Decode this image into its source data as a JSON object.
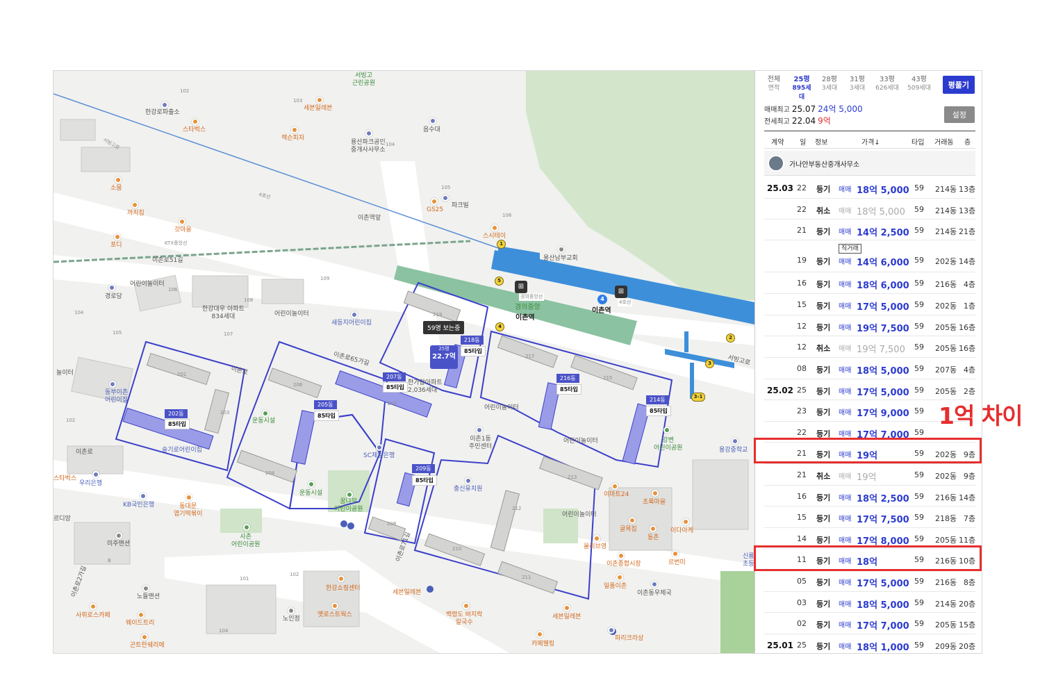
{
  "map": {
    "labels": {
      "seobinggo_park": "서빙고\n근린공원",
      "l102a": "102",
      "l103a": "103",
      "hangangro_police": "한강로파출소",
      "sebun_eleven_top": "세븐일레븐",
      "starbucks_top": "스타벅스",
      "jeksonpizza": "잭슨피자",
      "eumsudae": "음수대",
      "yongsan_park_agency": "용산파크공인\n중개사사무소",
      "l104a": "104",
      "l105a": "105",
      "gs25": "GS25",
      "parkbill": "파크빌",
      "l106a": "106",
      "seobinggoro": "서빙고로",
      "sopung": "소뭄",
      "kkachijip": "까치집",
      "gatmaeul": "갓마을",
      "podi": "포디",
      "ichon_station_name": "이촌역앞",
      "line4": "4호선",
      "ktx_jungang": "KTX중앙선",
      "steitei": "스시테이",
      "yongsan_church": "용산남부교회",
      "ichonro51": "이촌로51길",
      "kids_house": "어린이놀이터",
      "l106b": "106",
      "gyeongrodang": "경로당",
      "l104b": "104",
      "l105b": "105",
      "l108": "108",
      "l109": "109",
      "l107": "107",
      "hangang_daewoo": "한강대우 아파트\n834세대",
      "kids_house2": "어린이놀이터",
      "saedeungji_kindergarten": "새등지어린이집",
      "gyeongui_jungang": "경의중앙",
      "ichon_station": "이촌역",
      "ichon_station2": "이촌역",
      "gyeongui_line": "경의중앙선",
      "line4_badge": "4호선",
      "ichonro65": "이촌로65가길",
      "ichonro": "이촌로",
      "ichonro2": "이촌로",
      "dongbu_kindergarten": "동부이촌\n어린이집",
      "noriter_left": "놀이터",
      "l102b": "102",
      "l201": "201",
      "l203": "203",
      "l206": "206",
      "l207": "207",
      "l219": "219",
      "l217": "217",
      "l215": "215",
      "l204": "204",
      "l208": "208",
      "l210": "210",
      "l211": "211",
      "l212": "212",
      "l213": "213",
      "undong1": "운동시설",
      "undong2": "운동시설",
      "sc_bank": "SC제일은행",
      "kkumnamu": "꿈나무\n어린이공원",
      "chungsin_kindergarten": "충신유치원",
      "ichon1dong": "이촌1동\n주민센터",
      "kids_house3": "어린이놀이터",
      "kids_house4": "어린이놀이터",
      "kids_house5": "어린이놀이터",
      "ganggang_kinder": "강변\n어린이공원",
      "yonggang_middle": "용강중학교",
      "seobinggoro2": "서빙고로",
      "woori_bank": "우리은행",
      "kb_bank": "KB국민은행",
      "dongdaemun_tteok": "동대문\n엽기떡볶이",
      "starbucks_left": "스타벅스",
      "seulgiro_kinder": "슬기로어린이집",
      "mijumansion": "미주맨션",
      "l_b": "B",
      "saechon_park": "사촌\n어린이공원",
      "l101": "101",
      "l102c": "102",
      "hangang_shopping": "한강쇼핑센터",
      "sebun_eleven_bot": "세븐일레븐",
      "norudong": "노들맨션",
      "noinjeong": "노인정",
      "eoldi": "르디앙",
      "sawirostcafe": "사뤼로스카페",
      "weiditri": "웨이드트리",
      "goteuran": "곤트란쉐리에",
      "l104c": "104",
      "ichonro2gil": "이촌로2가길",
      "yepeuleoseuwokseu": "옛로스트웍스",
      "baekgyeongdo": "백령도 바지락\n칼국수",
      "ichonro71": "이촌로71길",
      "emart24": "이마트24",
      "chorokmaeul": "초록마을",
      "golmokjip": "골목집",
      "dongchun": "동촌",
      "idaiakkeu": "이다아케",
      "olibyeong": "올리브영",
      "ichon_market": "이촌종합시장",
      "ilpumichon": "일품이촌",
      "ichon_dongbu": "이촌동우체국",
      "reubeonmi": "르번미",
      "sebun_eleven_bot2": "세븐일레븐",
      "paris": "파리크라상",
      "kape": "카페웰링",
      "hangang_kindergarten": "한가람아파트\n2,036세대",
      "songpyeo": "신룡\n초등"
    },
    "complex_marker": {
      "viewers": "59명 보는중",
      "pyeong": "25평",
      "price": "22.7억"
    },
    "dong_tags": [
      {
        "dong": "202동",
        "type": "85타입"
      },
      {
        "dong": "205동",
        "type": "85타입"
      },
      {
        "dong": "207동",
        "type": "85타입"
      },
      {
        "dong": "218동",
        "type": "85타입"
      },
      {
        "dong": "216동",
        "type": "85타입"
      },
      {
        "dong": "214동",
        "type": "85타입"
      },
      {
        "dong": "209동",
        "type": "85타입"
      }
    ],
    "exits": [
      "1",
      "2",
      "3",
      "3-1",
      "4",
      "5"
    ],
    "line_badge": "4"
  },
  "panel": {
    "tabs": [
      {
        "top": "전체",
        "bottom": "면적"
      },
      {
        "top": "25평",
        "bottom": "895세대"
      },
      {
        "top": "28평",
        "bottom": "3세대"
      },
      {
        "top": "31평",
        "bottom": "3세대"
      },
      {
        "top": "33평",
        "bottom": "626세대"
      },
      {
        "top": "43평",
        "bottom": "509세대"
      }
    ],
    "unfold_button": "평풀기",
    "sale_max": {
      "label": "매매최고",
      "date": "25.07",
      "value": "24억 5,000"
    },
    "jeonse_max": {
      "label": "전세최고",
      "date": "22.04",
      "value": "9억"
    },
    "settings_button": "설정",
    "columns": {
      "contract": "계약",
      "day": "일",
      "info": "정보",
      "price": "가격↓",
      "type": "타입",
      "building": "거래동",
      "floor": "층"
    },
    "agency": "가나안부동산중개사무소",
    "rows": [
      {
        "month": "25.03",
        "day": "22",
        "info": "등기",
        "deal": "매매",
        "price": "18억 5,000",
        "type": "59",
        "bldg": "214동",
        "floor": "13층",
        "cancel": false
      },
      {
        "month": "",
        "day": "22",
        "info": "취소",
        "deal": "매매",
        "price": "18억 5,000",
        "type": "59",
        "bldg": "214동",
        "floor": "13층",
        "cancel": true
      },
      {
        "month": "",
        "day": "21",
        "info": "등기",
        "deal": "매매",
        "price": "14억 2,500",
        "type": "59",
        "bldg": "214동",
        "floor": "21층",
        "cancel": false
      },
      {
        "month": "",
        "day": "19",
        "info": "등기",
        "deal": "매매",
        "price": "14억 6,000",
        "type": "59",
        "bldg": "202동",
        "floor": "14층",
        "cancel": false,
        "tag": "직거래"
      },
      {
        "month": "",
        "day": "16",
        "info": "등기",
        "deal": "매매",
        "price": "18억 6,000",
        "type": "59",
        "bldg": "216동",
        "floor": "4층",
        "cancel": false
      },
      {
        "month": "",
        "day": "15",
        "info": "등기",
        "deal": "매매",
        "price": "17억 5,000",
        "type": "59",
        "bldg": "202동",
        "floor": "1층",
        "cancel": false
      },
      {
        "month": "",
        "day": "12",
        "info": "등기",
        "deal": "매매",
        "price": "19억 7,500",
        "type": "59",
        "bldg": "205동",
        "floor": "16층",
        "cancel": false
      },
      {
        "month": "",
        "day": "12",
        "info": "취소",
        "deal": "매매",
        "price": "19억 7,500",
        "type": "59",
        "bldg": "205동",
        "floor": "16층",
        "cancel": true
      },
      {
        "month": "",
        "day": "08",
        "info": "등기",
        "deal": "매매",
        "price": "18억 5,000",
        "type": "59",
        "bldg": "207동",
        "floor": "4층",
        "cancel": false
      },
      {
        "month": "25.02",
        "day": "25",
        "info": "등기",
        "deal": "매매",
        "price": "17억 5,000",
        "type": "59",
        "bldg": "205동",
        "floor": "2층",
        "cancel": false
      },
      {
        "month": "",
        "day": "23",
        "info": "등기",
        "deal": "매매",
        "price": "17억 9,000",
        "type": "59",
        "bldg": "",
        "floor": "",
        "cancel": false
      },
      {
        "month": "",
        "day": "22",
        "info": "등기",
        "deal": "매매",
        "price": "17억 7,000",
        "type": "59",
        "bldg": "",
        "floor": "",
        "cancel": false
      },
      {
        "month": "",
        "day": "21",
        "info": "등기",
        "deal": "매매",
        "price": "19억",
        "type": "59",
        "bldg": "202동",
        "floor": "9층",
        "cancel": false
      },
      {
        "month": "",
        "day": "21",
        "info": "취소",
        "deal": "매매",
        "price": "19억",
        "type": "59",
        "bldg": "202동",
        "floor": "9층",
        "cancel": true
      },
      {
        "month": "",
        "day": "16",
        "info": "등기",
        "deal": "매매",
        "price": "18억 2,500",
        "type": "59",
        "bldg": "216동",
        "floor": "14층",
        "cancel": false
      },
      {
        "month": "",
        "day": "15",
        "info": "등기",
        "deal": "매매",
        "price": "17억 7,500",
        "type": "59",
        "bldg": "218동",
        "floor": "7층",
        "cancel": false
      },
      {
        "month": "",
        "day": "14",
        "info": "등기",
        "deal": "매매",
        "price": "17억 8,000",
        "type": "59",
        "bldg": "205동",
        "floor": "11층",
        "cancel": false
      },
      {
        "month": "",
        "day": "11",
        "info": "등기",
        "deal": "매매",
        "price": "18억",
        "type": "59",
        "bldg": "216동",
        "floor": "10층",
        "cancel": false
      },
      {
        "month": "",
        "day": "05",
        "info": "등기",
        "deal": "매매",
        "price": "17억 5,000",
        "type": "59",
        "bldg": "216동",
        "floor": "8층",
        "cancel": false
      },
      {
        "month": "",
        "day": "03",
        "info": "등기",
        "deal": "매매",
        "price": "18억 5,000",
        "type": "59",
        "bldg": "214동",
        "floor": "20층",
        "cancel": false
      },
      {
        "month": "",
        "day": "02",
        "info": "등기",
        "deal": "매매",
        "price": "17억 7,000",
        "type": "59",
        "bldg": "205동",
        "floor": "15층",
        "cancel": false
      },
      {
        "month": "25.01",
        "day": "25",
        "info": "등기",
        "deal": "매매",
        "price": "18억 1,000",
        "type": "59",
        "bldg": "209동",
        "floor": "20층",
        "cancel": false
      }
    ]
  },
  "annotation": {
    "diff_label": "1억 차이",
    "color": "#e52e2e"
  },
  "colors": {
    "accent": "#2c3bcf",
    "complex_outline": "#3b3fc9",
    "complex_fill": "#9a9ce8",
    "subway_line4": "#3d8fd9",
    "park_green": "#cfe4c8",
    "ktx_line": "#6aa58a"
  }
}
